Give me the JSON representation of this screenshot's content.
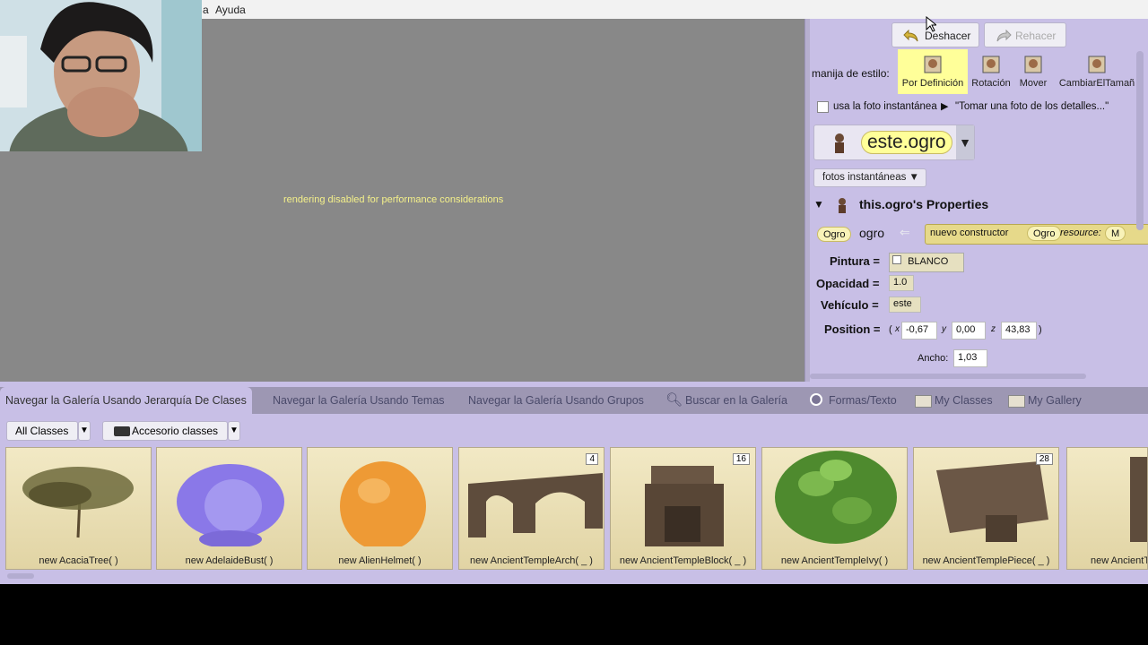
{
  "menubar": {
    "items": [
      "a",
      "Ayuda"
    ]
  },
  "scene": {
    "message": "rendering disabled for performance considerations"
  },
  "toolbar": {
    "undo_label": "Deshacer",
    "redo_label": "Rehacer"
  },
  "style_handles": {
    "label": "manija de estilo:",
    "items": [
      "Por Definición",
      "Rotación",
      "Mover",
      "CambiarElTamañ"
    ]
  },
  "snapshot": {
    "checkbox_label": "usa la foto instantánea",
    "hint": "\"Tomar una foto de los detalles...\"",
    "button_label": "fotos instantáneas ▼"
  },
  "selector": {
    "current": "este.ogro"
  },
  "properties": {
    "title": "this.ogro's Properties",
    "type_badge": "Ogro",
    "var_name": "ogro",
    "constructor_label": "nuevo constructor",
    "constructor_arg": "Ogro",
    "resource_label": "resource:",
    "resource_value": "M",
    "paint_label": "Pintura =",
    "paint_value": "BLANCO",
    "opacity_label": "Opacidad =",
    "opacity_value": "1.0",
    "vehicle_label": "Vehículo =",
    "vehicle_value": "este",
    "position_label": "Position =",
    "position": {
      "x_label": "x",
      "x": "-0,67",
      "y_label": "y",
      "y": "0,00",
      "z_label": "z",
      "z": "43,83"
    },
    "width_label": "Ancho:",
    "width_value": "1,03"
  },
  "tabs": [
    "Navegar la Galería Usando Jerarquía De Clases",
    "Navegar la Galería Usando Temas",
    "Navegar la Galería Usando Grupos",
    "Buscar en la Galería",
    "Formas/Texto",
    "My Classes",
    "My Gallery"
  ],
  "gallery": {
    "filter1": "All Classes",
    "filter2": "Accesorio classes",
    "tiles": [
      {
        "caption": "new AcaciaTree( )",
        "count": ""
      },
      {
        "caption": "new AdelaideBust( )",
        "count": ""
      },
      {
        "caption": "new AlienHelmet( )",
        "count": ""
      },
      {
        "caption": "new AncientTempleArch( _ )",
        "count": "4"
      },
      {
        "caption": "new AncientTempleBlock( _ )",
        "count": "16"
      },
      {
        "caption": "new AncientTempleIvy( )",
        "count": ""
      },
      {
        "caption": "new AncientTemplePiece( _ )",
        "count": "28"
      },
      {
        "caption": "new AncientTe",
        "count": ""
      }
    ]
  },
  "colors": {
    "panel": "#c8bfe6",
    "scene": "#888888",
    "accent_yellow": "#ffff99"
  }
}
